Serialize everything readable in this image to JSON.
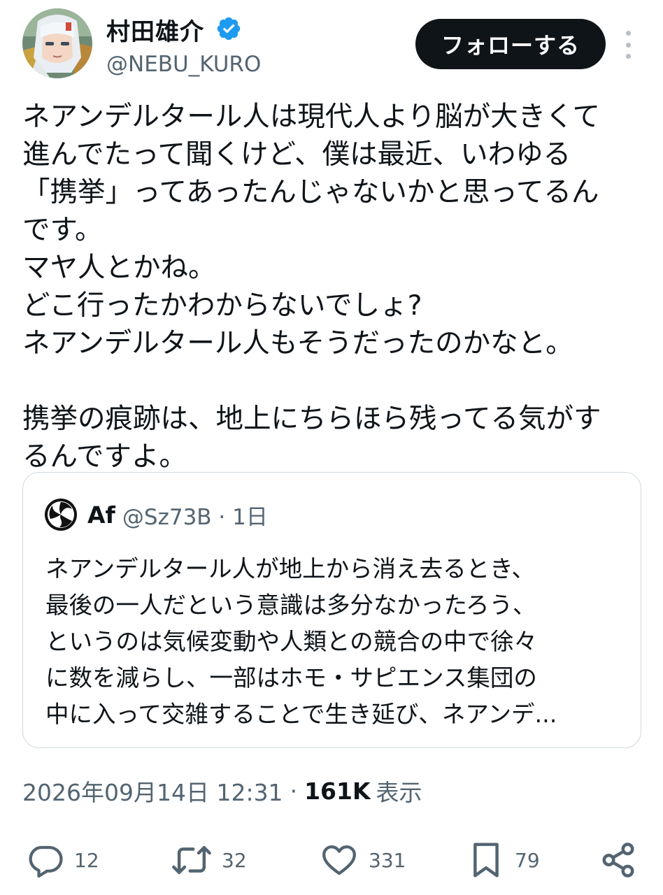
{
  "author": {
    "display_name": "村田雄介",
    "handle": "@NEBU_KURO",
    "verified_icon": "verified-badge-icon"
  },
  "buttons": {
    "follow_label": "フォローする",
    "more_icon": "more-vertical-icon"
  },
  "tweet": {
    "lines": [
      "ネアンデルタール人は現代人より脳が大きくて",
      "進んでたって聞くけど、僕は最近、いわゆる",
      "「携挙」ってあったんじゃないかと思ってるん",
      "です。",
      "マヤ人とかね。",
      "どこ行ったかわからないでしょ?",
      "ネアンデルタール人もそうだったのかなと。",
      "",
      "携挙の痕跡は、地上にちらほら残ってる気がす",
      "るんですよ。"
    ]
  },
  "quote": {
    "name": "Af",
    "handle_time": "@Sz73B · 1日",
    "lines": [
      "ネアンデルタール人が地上から消え去るとき、",
      "最後の一人だという意識は多分なかったろう、",
      "というのは気候変動や人類との競合の中で徐々",
      "に数を減らし、一部はホモ・サピエンス集団の",
      "中に入って交雑することで生き延び、ネアンデ..."
    ]
  },
  "meta": {
    "timestamp": "2026年09月14日 12:31",
    "separator": "·",
    "views_count": "161K",
    "views_label": "表示"
  },
  "actions": {
    "reply": {
      "icon": "reply-icon",
      "count": "12"
    },
    "retweet": {
      "icon": "retweet-icon",
      "count": "32"
    },
    "like": {
      "icon": "heart-icon",
      "count": "331"
    },
    "bookmark": {
      "icon": "bookmark-icon",
      "count": "79"
    },
    "share": {
      "icon": "share-icon"
    }
  },
  "colors": {
    "text": "#0f1419",
    "secondary": "#536471",
    "verified": "#1d9bf0",
    "border": "#cfd9de",
    "button_bg": "#0f1419"
  }
}
